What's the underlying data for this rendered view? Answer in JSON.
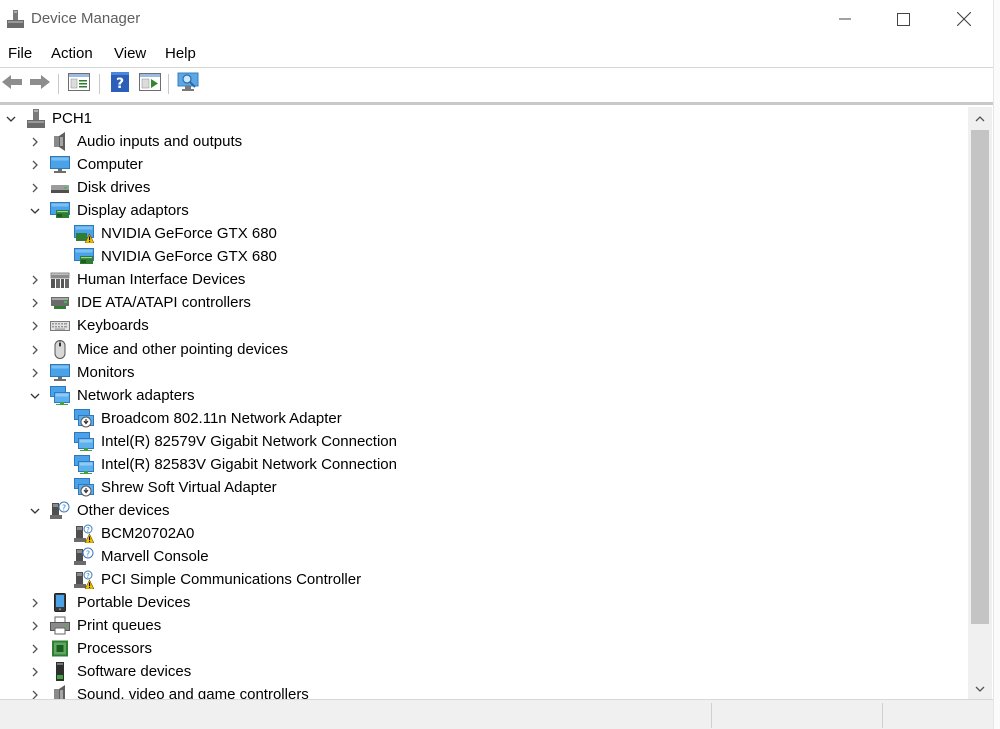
{
  "window": {
    "title": "Device Manager"
  },
  "menu": [
    {
      "label": "File"
    },
    {
      "label": "Action"
    },
    {
      "label": "View"
    },
    {
      "label": "Help"
    }
  ],
  "toolbar": {
    "buttons": [
      "back-icon",
      "forward-icon",
      "properties-icon",
      "help-icon",
      "run-icon",
      "scan-hardware-icon"
    ]
  },
  "tree": {
    "root": {
      "label": "PCH1",
      "icon": "computer-icon",
      "expanded": true
    },
    "nodes": [
      {
        "label": "Audio inputs and outputs",
        "icon": "speaker-icon",
        "level": 1,
        "state": "collapsed"
      },
      {
        "label": "Computer",
        "icon": "monitor-icon",
        "level": 1,
        "state": "collapsed"
      },
      {
        "label": "Disk drives",
        "icon": "disk-drive-icon",
        "level": 1,
        "state": "collapsed"
      },
      {
        "label": "Display adaptors",
        "icon": "display-adapter-icon",
        "level": 1,
        "state": "expanded"
      },
      {
        "label": "NVIDIA GeForce GTX 680",
        "icon": "display-adapter-warning-icon",
        "level": 2,
        "state": "leaf"
      },
      {
        "label": "NVIDIA GeForce GTX 680",
        "icon": "display-adapter-icon",
        "level": 2,
        "state": "leaf"
      },
      {
        "label": "Human Interface Devices",
        "icon": "hid-icon",
        "level": 1,
        "state": "collapsed"
      },
      {
        "label": "IDE ATA/ATAPI controllers",
        "icon": "ide-controller-icon",
        "level": 1,
        "state": "collapsed"
      },
      {
        "label": "Keyboards",
        "icon": "keyboard-icon",
        "level": 1,
        "state": "collapsed"
      },
      {
        "label": "Mice and other pointing devices",
        "icon": "mouse-icon",
        "level": 1,
        "state": "collapsed"
      },
      {
        "label": "Monitors",
        "icon": "monitor-icon",
        "level": 1,
        "state": "collapsed"
      },
      {
        "label": "Network adapters",
        "icon": "network-adapter-icon",
        "level": 1,
        "state": "expanded"
      },
      {
        "label": "Broadcom 802.11n Network Adapter",
        "icon": "network-adapter-disabled-icon",
        "level": 2,
        "state": "leaf"
      },
      {
        "label": "Intel(R) 82579V Gigabit Network Connection",
        "icon": "network-adapter-icon",
        "level": 2,
        "state": "leaf"
      },
      {
        "label": "Intel(R) 82583V Gigabit Network Connection",
        "icon": "network-adapter-icon",
        "level": 2,
        "state": "leaf"
      },
      {
        "label": "Shrew Soft Virtual Adapter",
        "icon": "network-adapter-disabled-icon",
        "level": 2,
        "state": "leaf"
      },
      {
        "label": "Other devices",
        "icon": "unknown-device-icon",
        "level": 1,
        "state": "expanded"
      },
      {
        "label": "BCM20702A0",
        "icon": "unknown-device-warning-icon",
        "level": 2,
        "state": "leaf"
      },
      {
        "label": "Marvell Console",
        "icon": "unknown-device-icon",
        "level": 2,
        "state": "leaf"
      },
      {
        "label": "PCI Simple Communications Controller",
        "icon": "unknown-device-warning-icon",
        "level": 2,
        "state": "leaf"
      },
      {
        "label": "Portable Devices",
        "icon": "portable-device-icon",
        "level": 1,
        "state": "collapsed"
      },
      {
        "label": "Print queues",
        "icon": "printer-icon",
        "level": 1,
        "state": "collapsed"
      },
      {
        "label": "Processors",
        "icon": "processor-icon",
        "level": 1,
        "state": "collapsed"
      },
      {
        "label": "Software devices",
        "icon": "software-device-icon",
        "level": 1,
        "state": "collapsed"
      },
      {
        "label": "Sound, video and game controllers",
        "icon": "speaker-icon",
        "level": 1,
        "state": "collapsed"
      }
    ]
  },
  "colors": {
    "accent": "#3a8ee6",
    "warning": "#f2c100"
  }
}
